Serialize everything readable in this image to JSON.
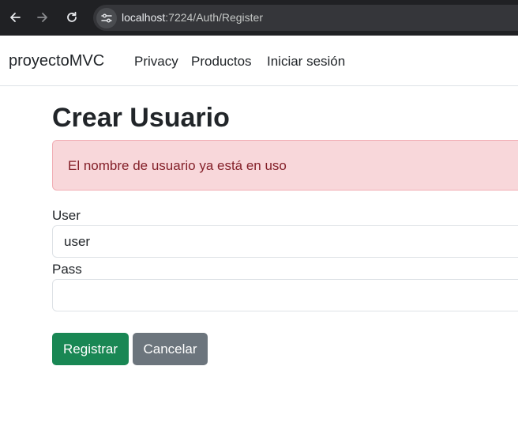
{
  "browser": {
    "url_host": "localhost",
    "url_path": ":7224/Auth/Register",
    "icons": [
      "back-arrow-icon",
      "forward-arrow-icon",
      "reload-icon",
      "site-info-icon"
    ]
  },
  "navbar": {
    "brand": "proyectoMVC",
    "links": [
      "Privacy",
      "Productos",
      "Iniciar sesión"
    ]
  },
  "main": {
    "title": "Crear Usuario",
    "alert_message": "El nombre de usuario ya está en uso",
    "user_label": "User",
    "user_value": "user",
    "pass_label": "Pass",
    "pass_value": "",
    "register_button": "Registrar",
    "cancel_button": "Cancelar"
  },
  "colors": {
    "browser_bg": "#202124",
    "alert_bg": "#f8d7da",
    "alert_text": "#842029",
    "success": "#198754",
    "secondary": "#6c757d"
  }
}
